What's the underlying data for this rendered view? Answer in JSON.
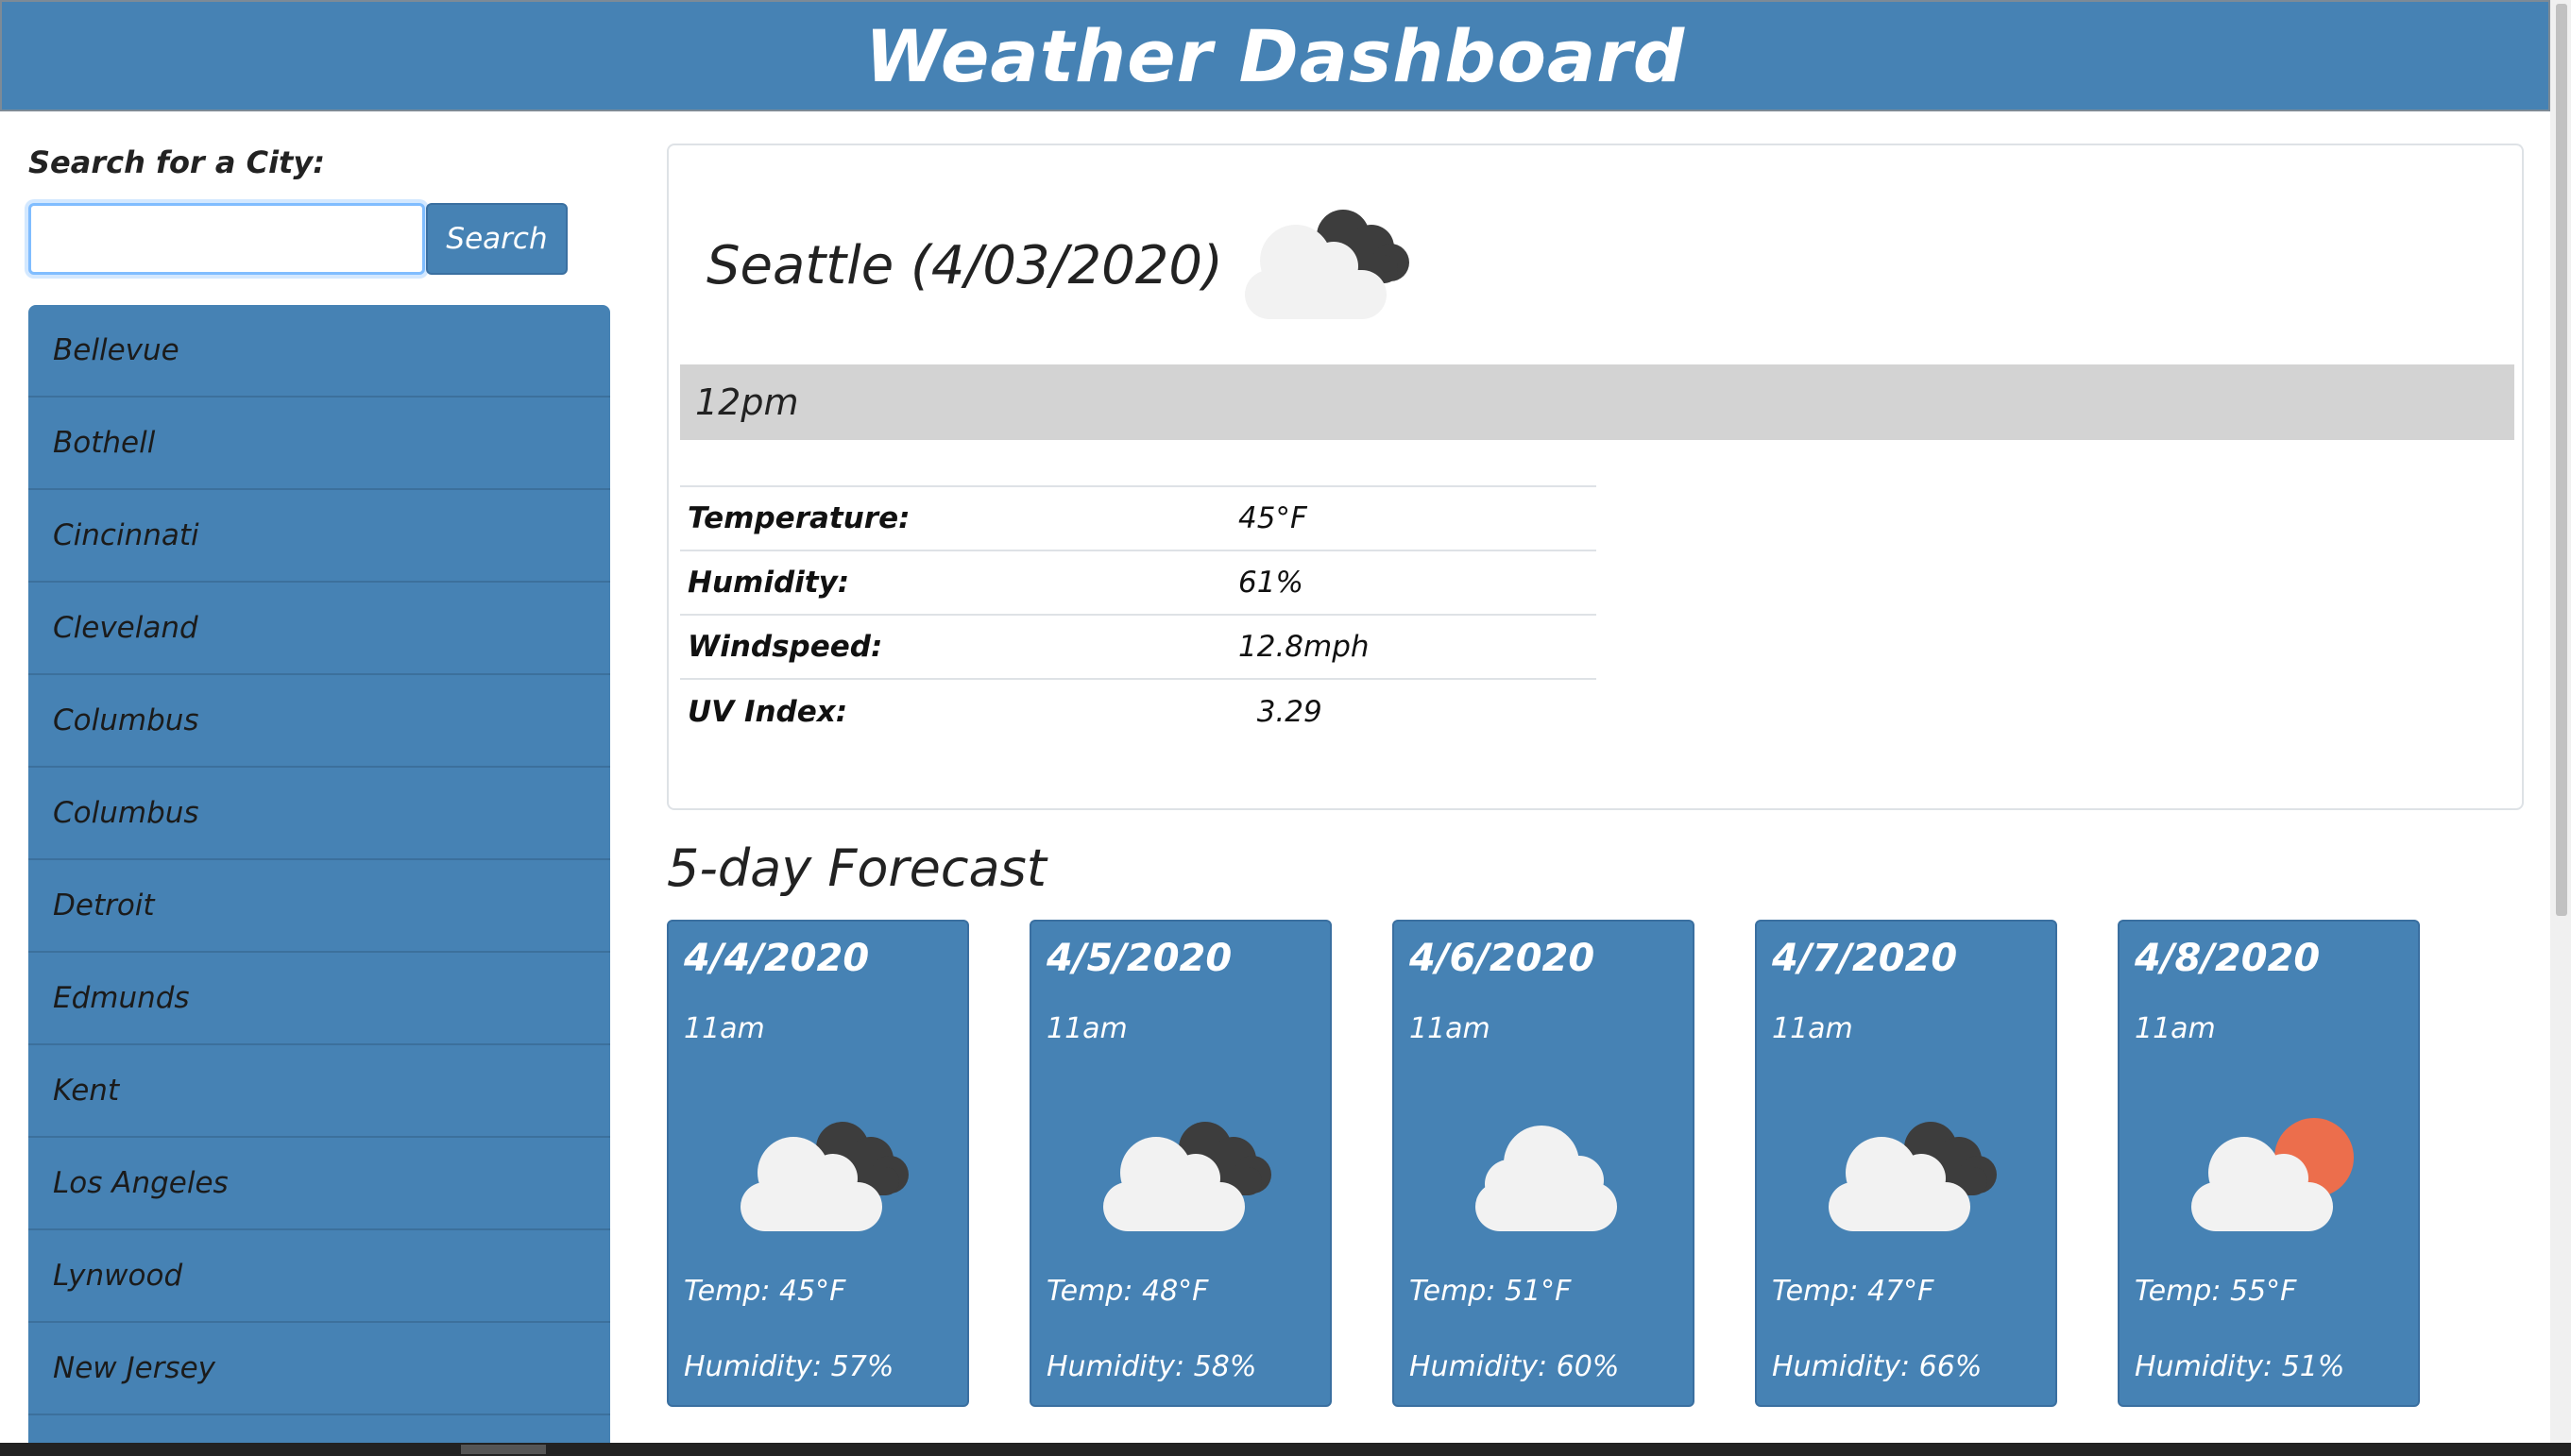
{
  "header": {
    "title": "Weather Dashboard"
  },
  "sidebar": {
    "search_label": "Search for a City:",
    "search_value": "",
    "search_button": "Search",
    "cities": [
      "Bellevue",
      "Bothell",
      "Cincinnati",
      "Cleveland",
      "Columbus",
      "Columbus",
      "Detroit",
      "Edmunds",
      "Kent",
      "Los Angeles",
      "Lynwood",
      "New Jersey",
      ""
    ]
  },
  "current": {
    "city_date": "Seattle (4/03/2020)",
    "icon": "dark-clouds-icon",
    "time": "12pm",
    "stats": [
      {
        "label": "Temperature:",
        "value": "45°F"
      },
      {
        "label": "Humidity:",
        "value": "61%"
      },
      {
        "label": "Windspeed:",
        "value": "12.8mph"
      },
      {
        "label": "UV Index:",
        "value": "  3.29"
      }
    ]
  },
  "forecast": {
    "title": "5-day Forecast",
    "days": [
      {
        "date": "4/4/2020",
        "time": "11am",
        "icon": "dark-clouds-icon",
        "temp": "Temp: 45°F",
        "humidity": "Humidity: 57%"
      },
      {
        "date": "4/5/2020",
        "time": "11am",
        "icon": "dark-clouds-icon",
        "temp": "Temp: 48°F",
        "humidity": "Humidity: 58%"
      },
      {
        "date": "4/6/2020",
        "time": "11am",
        "icon": "cloud-icon",
        "temp": "Temp: 51°F",
        "humidity": "Humidity: 60%"
      },
      {
        "date": "4/7/2020",
        "time": "11am",
        "icon": "dark-clouds-icon",
        "temp": "Temp: 47°F",
        "humidity": "Humidity: 66%"
      },
      {
        "date": "4/8/2020",
        "time": "11am",
        "icon": "partly-cloudy-icon",
        "temp": "Temp: 55°F",
        "humidity": "Humidity: 51%"
      }
    ]
  },
  "colors": {
    "primary": "#4682b4",
    "time_bar": "#d3d3d3",
    "cloud_light": "#f2f2f2",
    "cloud_dark": "#3d3d3d",
    "sun": "#ec6e4c"
  }
}
